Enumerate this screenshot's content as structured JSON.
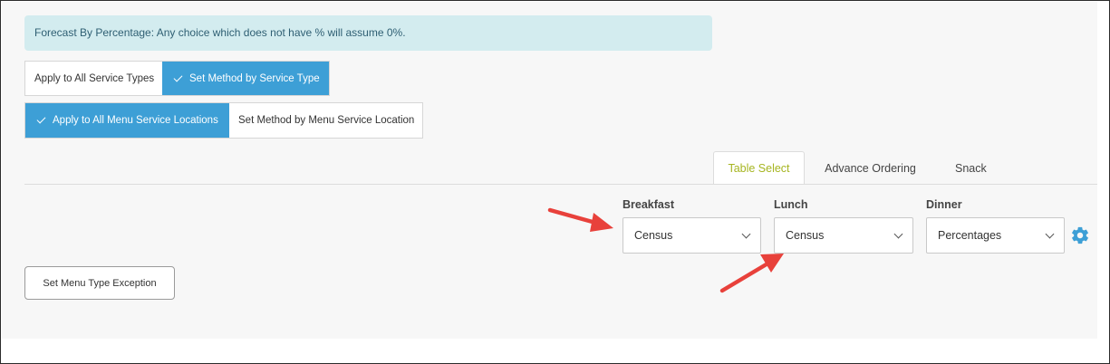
{
  "alert": {
    "text": "Forecast By Percentage: Any choice which does not have % will assume 0%."
  },
  "service_type_toggle": {
    "options": [
      {
        "label": "Apply to All Service Types",
        "selected": false
      },
      {
        "label": "Set Method by Service Type",
        "selected": true
      }
    ]
  },
  "location_toggle": {
    "options": [
      {
        "label": "Apply to All Menu Service Locations",
        "selected": true
      },
      {
        "label": "Set Method by Menu Service Location",
        "selected": false
      }
    ]
  },
  "tabs": [
    {
      "label": "Table Select",
      "active": true
    },
    {
      "label": "Advance Ordering",
      "active": false
    },
    {
      "label": "Snack",
      "active": false
    }
  ],
  "meals": {
    "breakfast": {
      "label": "Breakfast",
      "value": "Census"
    },
    "lunch": {
      "label": "Lunch",
      "value": "Census"
    },
    "dinner": {
      "label": "Dinner",
      "value": "Percentages"
    }
  },
  "actions": {
    "exception_label": "Set Menu Type Exception"
  },
  "icons": {
    "settings": "gear-icon",
    "check": "checkmark-icon",
    "dropdown": "chevron-down-icon",
    "annotation": "red-arrow"
  },
  "colors": {
    "accent": "#3d9fd6",
    "active_tab": "#a6b521",
    "alert_bg": "#d3ecef",
    "alert_text": "#2f5f73",
    "annotation_arrow": "#e8413b"
  }
}
